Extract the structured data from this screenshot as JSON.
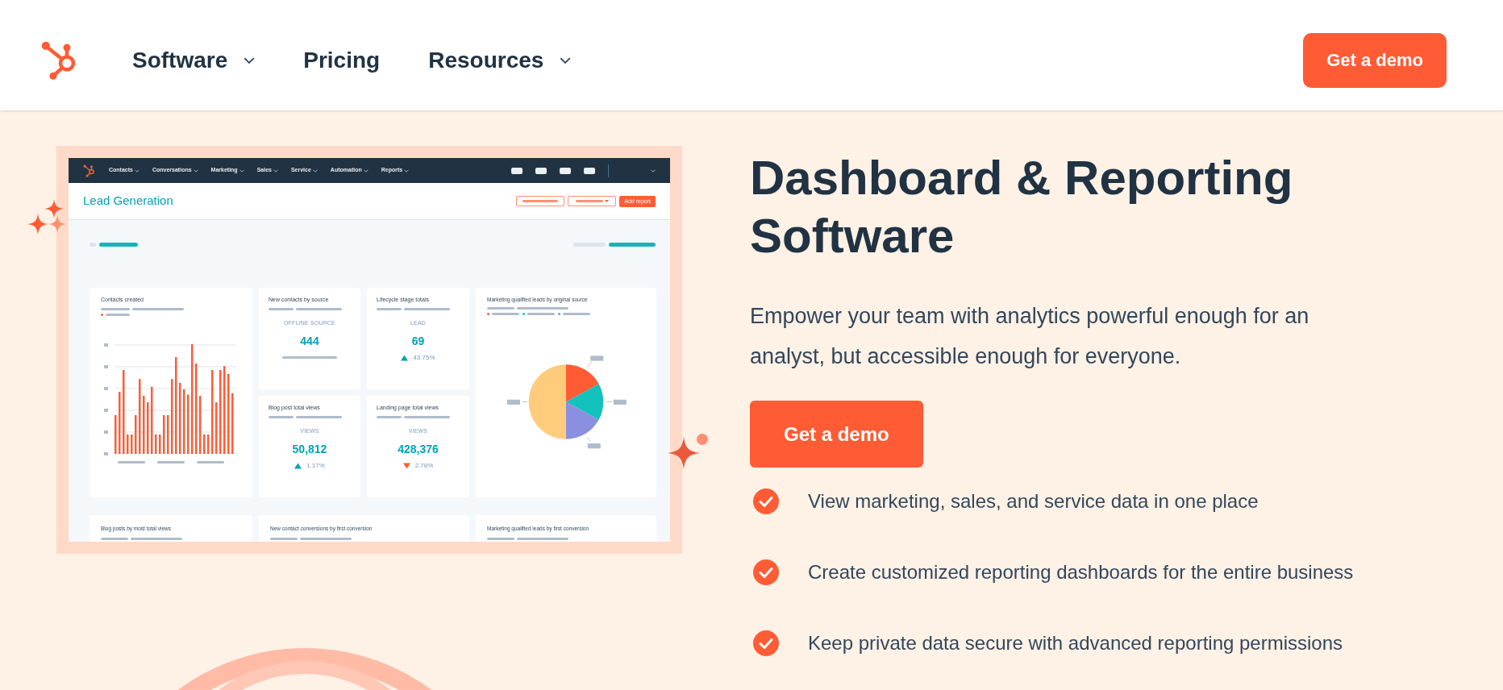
{
  "header": {
    "nav": [
      {
        "label": "Software",
        "dropdown": true
      },
      {
        "label": "Pricing",
        "dropdown": false
      },
      {
        "label": "Resources",
        "dropdown": true
      }
    ],
    "cta": "Get a demo"
  },
  "dashboard": {
    "nav": [
      {
        "label": "Contacts"
      },
      {
        "label": "Conversations"
      },
      {
        "label": "Marketing"
      },
      {
        "label": "Sales"
      },
      {
        "label": "Service"
      },
      {
        "label": "Automation"
      },
      {
        "label": "Reports"
      }
    ],
    "page_title": "Lead Generation",
    "add_button": "Add report",
    "chart_card": {
      "title": "Contacts created"
    },
    "stats": [
      {
        "title": "New contacts by source",
        "label": "OFFLINE SOURCE",
        "value": "444"
      },
      {
        "title": "Lifecycle stage totals",
        "label": "LEAD",
        "value": "69",
        "up": true,
        "change": "43.75%"
      },
      {
        "title": "Blog post total views",
        "label": "VIEWS",
        "value": "50,812",
        "up": true,
        "change": "1.17%"
      },
      {
        "title": "Landing page total views",
        "label": "VIEWS",
        "value": "428,376",
        "up": false,
        "change": "2.78%"
      }
    ],
    "pie_card": {
      "title": "Marketing qualified leads by original source"
    },
    "bottom_cards": [
      {
        "title": "Blog posts by most total views"
      },
      {
        "title": "New contact conversions by first conversion"
      },
      {
        "title": "Marketing qualified leads by first conversion"
      }
    ]
  },
  "hero": {
    "title": "Dashboard & Reporting Software",
    "description": "Empower your team with analytics powerful enough for an analyst, but accessible enough for everyone.",
    "cta": "Get a demo",
    "features": [
      "View marketing, sales, and service data in one place",
      "Create customized reporting dashboards for the entire business",
      "Keep private data secure with advanced reporting permissions"
    ]
  }
}
